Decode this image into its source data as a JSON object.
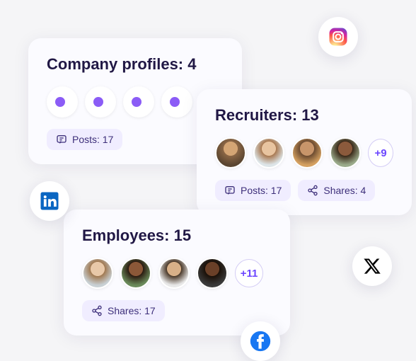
{
  "cards": {
    "company": {
      "title": "Company profiles: 4",
      "posts_label": "Posts: 17"
    },
    "recruiters": {
      "title": "Recruiters: 13",
      "more": "+9",
      "posts_label": "Posts: 17",
      "shares_label": "Shares: 4"
    },
    "employees": {
      "title": "Employees: 15",
      "more": "+11",
      "shares_label": "Shares: 17"
    }
  },
  "social_icons": {
    "instagram": "instagram-icon",
    "linkedin": "linkedin-icon",
    "x": "x-icon",
    "facebook": "facebook-icon"
  },
  "colors": {
    "accent": "#6b46ff",
    "pill_bg": "#f0edff",
    "text_dark": "#211845"
  }
}
